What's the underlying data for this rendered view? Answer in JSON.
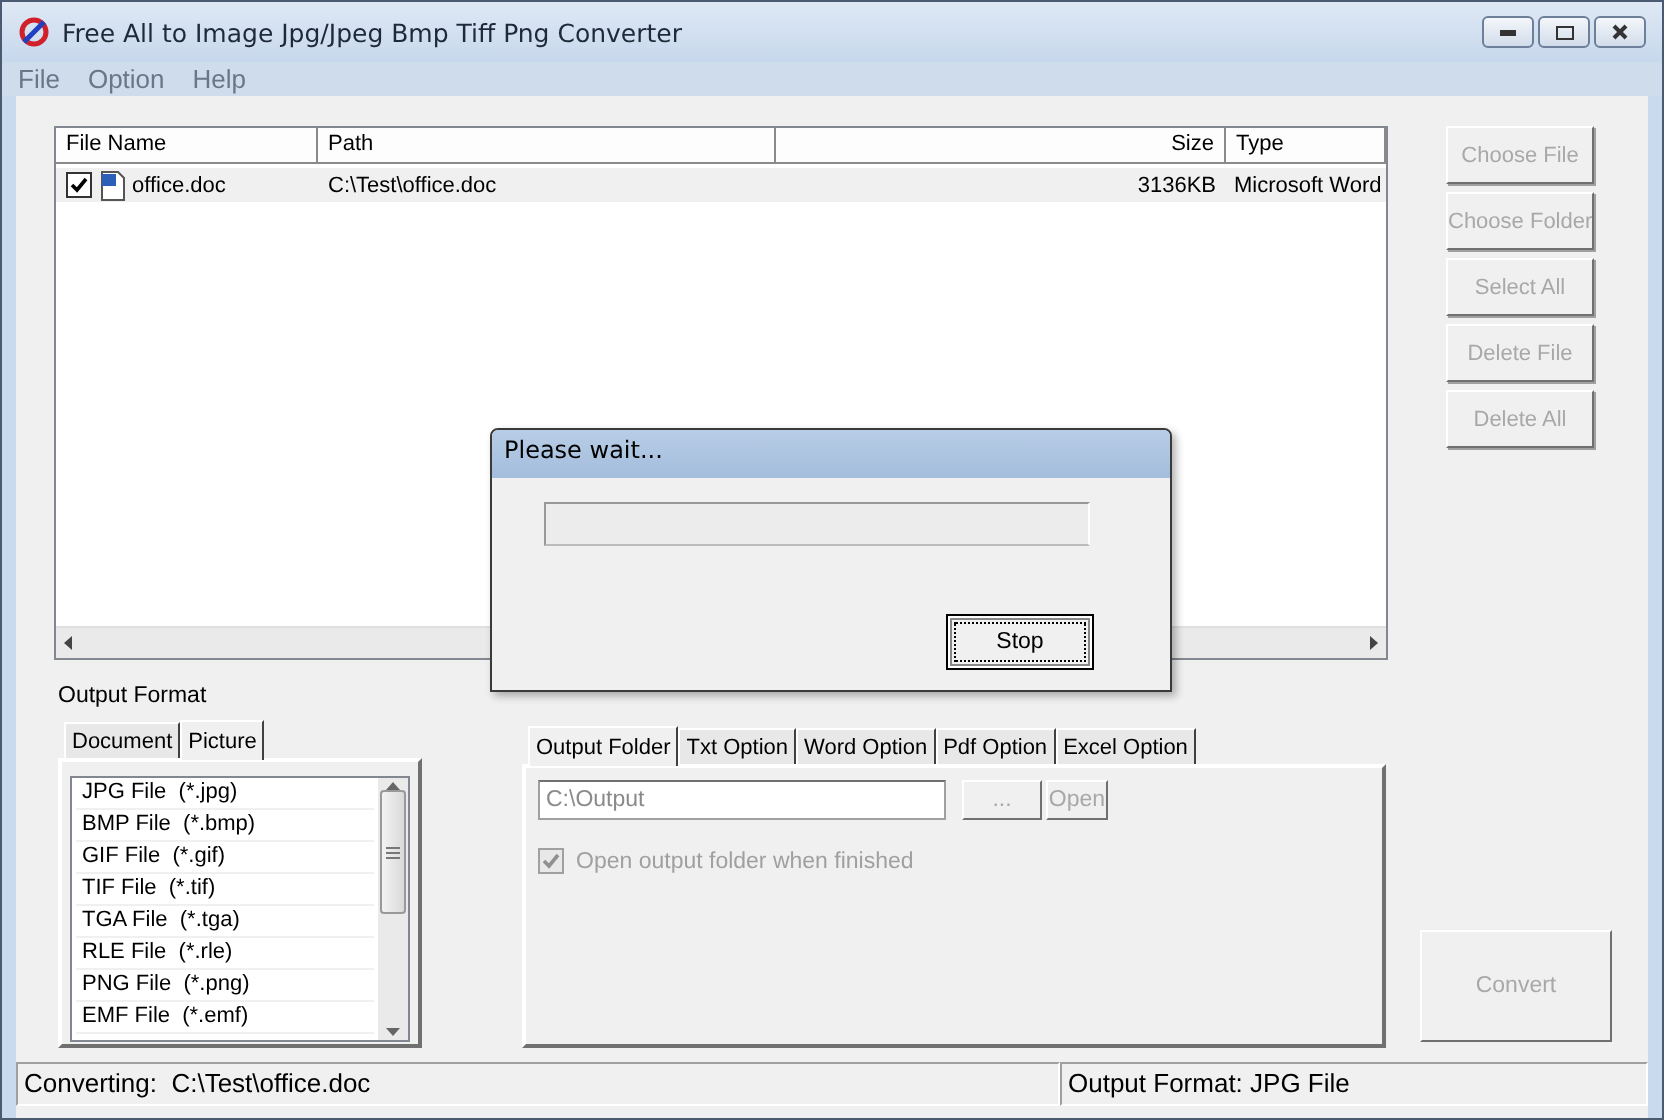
{
  "window": {
    "title": "Free All to Image Jpg/Jpeg Bmp Tiff Png Converter"
  },
  "menu": [
    "File",
    "Option",
    "Help"
  ],
  "file_list": {
    "columns": [
      "File Name",
      "Path",
      "Size",
      "Type"
    ],
    "rows": [
      {
        "checked": true,
        "selected": true,
        "name": "office.doc",
        "path": "C:\\Test\\office.doc",
        "size": "3136KB",
        "type": "Microsoft Word"
      }
    ]
  },
  "side_buttons": [
    {
      "label": "Choose File",
      "disabled": true
    },
    {
      "label": "Choose Folder",
      "disabled": true
    },
    {
      "label": "Select All",
      "disabled": true
    },
    {
      "label": "Delete File",
      "disabled": true
    },
    {
      "label": "Delete All",
      "disabled": true
    }
  ],
  "output_format": {
    "label": "Output Format",
    "tabs": [
      {
        "label": "Document",
        "selected": false
      },
      {
        "label": "Picture",
        "selected": true
      }
    ],
    "formats": [
      "JPG File  (*.jpg)",
      "BMP File  (*.bmp)",
      "GIF File  (*.gif)",
      "TIF File  (*.tif)",
      "TGA File  (*.tga)",
      "RLE File  (*.rle)",
      "PNG File  (*.png)",
      "EMF File  (*.emf)"
    ]
  },
  "option_tabs": [
    {
      "label": "Output Folder",
      "selected": true
    },
    {
      "label": "Txt Option",
      "selected": false
    },
    {
      "label": "Word Option",
      "selected": false
    },
    {
      "label": "Pdf Option",
      "selected": false
    },
    {
      "label": "Excel Option",
      "selected": false
    }
  ],
  "output_folder": {
    "value": "C:\\Output",
    "disabled": true,
    "browse_button": "...",
    "open_button": "Open",
    "open_when_finished": {
      "label": "Open output folder when finished",
      "checked": true
    }
  },
  "convert_button": {
    "label": "Convert",
    "disabled": true
  },
  "status_bar": [
    "Converting:  C:\\Test\\office.doc",
    "Output Format: JPG File"
  ],
  "dialog": {
    "title": "Please wait...",
    "progress": {
      "level": 0
    },
    "stop_button": "Stop"
  }
}
